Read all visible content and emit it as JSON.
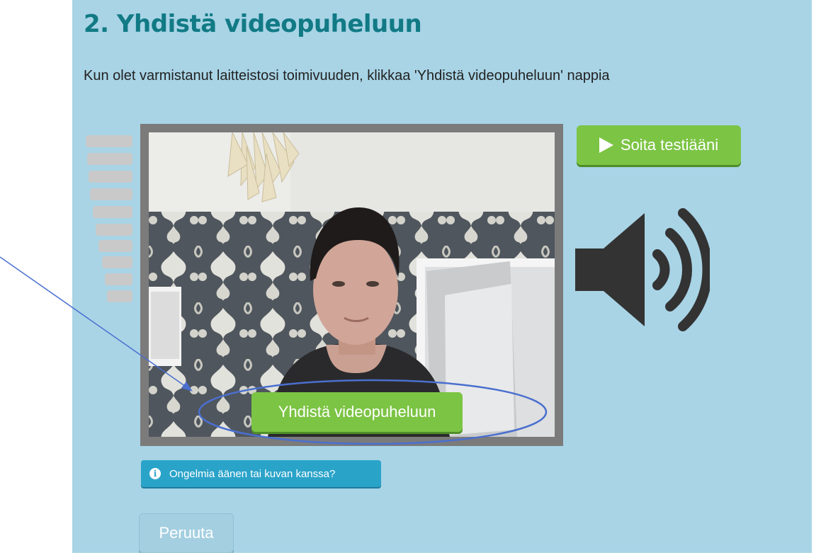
{
  "page": {
    "title": "2. Yhdistä videopuheluun",
    "instruction": "Kun olet varmistanut laitteistosi toimivuuden, klikkaa 'Yhdistä videopuheluun' nappia"
  },
  "video": {
    "connect_label": "Yhdistä videopuheluun"
  },
  "controls": {
    "test_sound_label": "Soita testiääni",
    "help_label": "Ongelmia äänen tai kuvan kanssa?",
    "cancel_label": "Peruuta"
  },
  "icons": {
    "play": "play-icon",
    "speaker": "speaker-volume-icon",
    "info": "info-icon"
  },
  "microphone_level": {
    "active_bars": 0,
    "total_bars": 10
  },
  "colors": {
    "background": "#a8d4e6",
    "title": "#117a85",
    "green_button": "#7cc444",
    "help_button": "#2aa3c9",
    "annotation": "#4a6fcf"
  }
}
